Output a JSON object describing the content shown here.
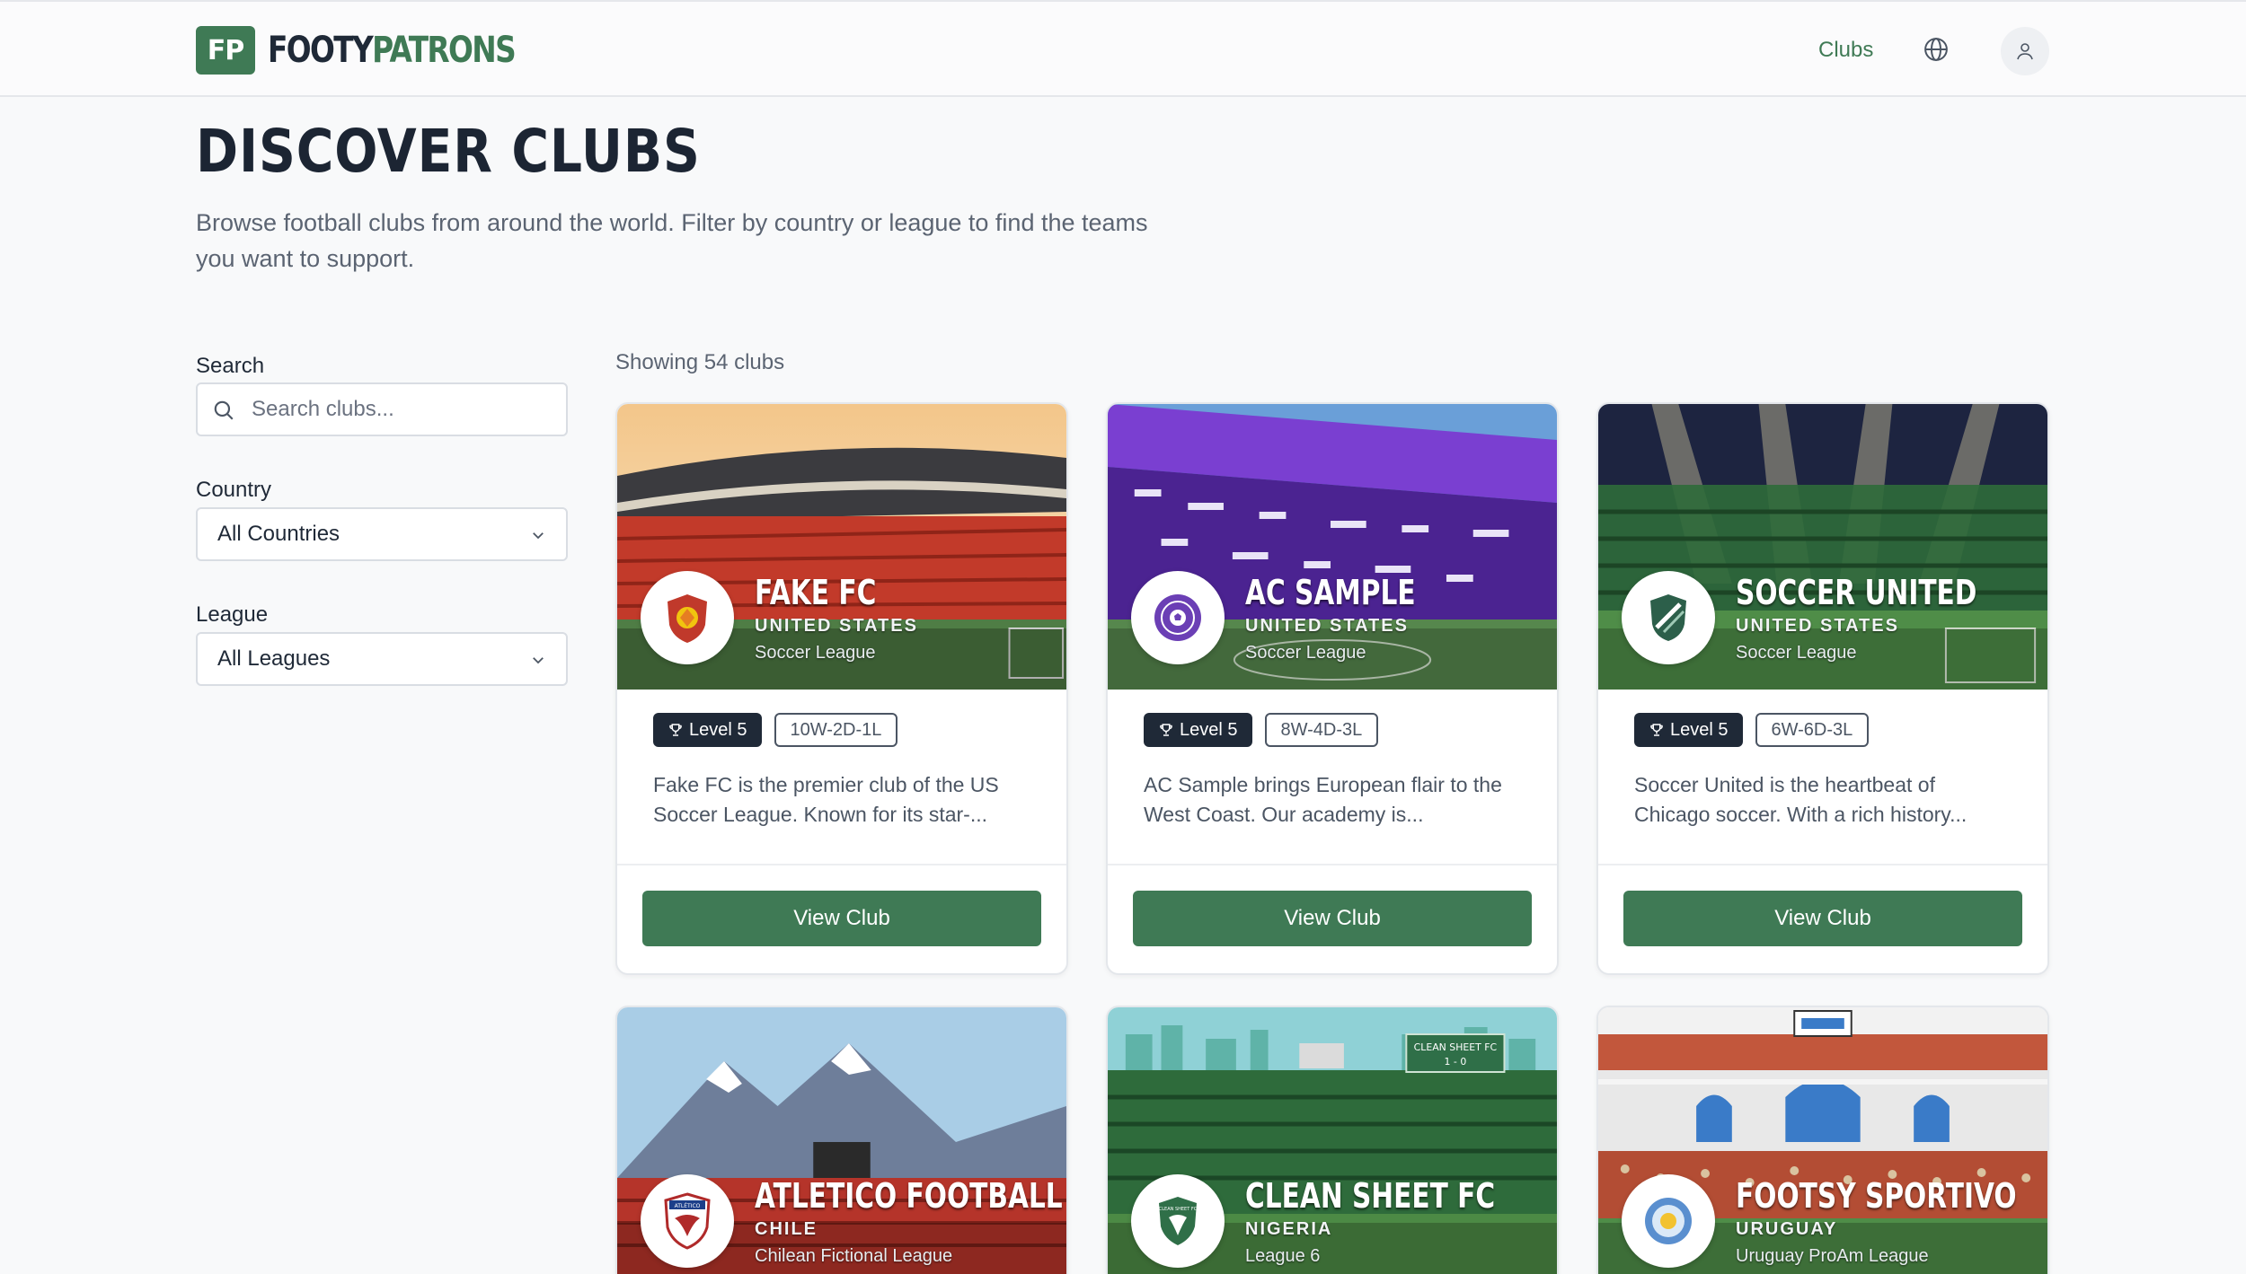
{
  "brand": {
    "badge": "FP",
    "name_part1": "FOOTY",
    "name_part2": "PATRONS"
  },
  "nav": {
    "clubs_label": "Clubs",
    "globe_icon": "globe-icon",
    "user_icon": "user-icon"
  },
  "hero": {
    "title": "DISCOVER CLUBS",
    "subtitle": "Browse football clubs from around the world. Filter by country or league to find the teams you want to support."
  },
  "filters": {
    "search_label": "Search",
    "search_placeholder": "Search clubs...",
    "country_label": "Country",
    "country_value": "All Countries",
    "league_label": "League",
    "league_value": "All Leagues"
  },
  "results": {
    "showing": "Showing 54 clubs"
  },
  "clubs": [
    {
      "name": "FAKE FC",
      "country": "UNITED STATES",
      "league": "Soccer League",
      "level": "Level 5",
      "record": "10W-2D-1L",
      "description": "Fake FC is the premier club of the US Soccer League. Known for its star-...",
      "button": "View Club"
    },
    {
      "name": "AC SAMPLE",
      "country": "UNITED STATES",
      "league": "Soccer League",
      "level": "Level 5",
      "record": "8W-4D-3L",
      "description": "AC Sample brings European flair to the West Coast. Our academy is...",
      "button": "View Club"
    },
    {
      "name": "SOCCER UNITED",
      "country": "UNITED STATES",
      "league": "Soccer League",
      "level": "Level 5",
      "record": "6W-6D-3L",
      "description": "Soccer United is the heartbeat of Chicago soccer. With a rich history...",
      "button": "View Club"
    },
    {
      "name": "ATLETICO FOOTBALL",
      "country": "CHILE",
      "league": "Chilean Fictional League",
      "crest_text": "ATLÉTICO"
    },
    {
      "name": "CLEAN SHEET FC",
      "country": "NIGERIA",
      "league": "League 6",
      "scoreboard_name": "CLEAN SHEET FC",
      "scoreboard_score": "1 - 0",
      "crest_text": "CLEAN SHEET FC"
    },
    {
      "name": "FOOTSY SPORTIVO",
      "country": "URUGUAY",
      "league": "Uruguay ProAm League"
    }
  ],
  "colors": {
    "brand_green": "#3f7a55",
    "dark": "#1f2937"
  }
}
